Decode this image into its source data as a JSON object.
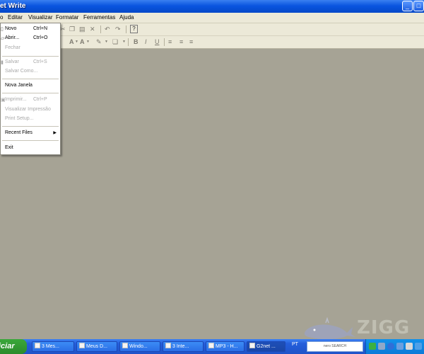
{
  "window": {
    "title": "et Write"
  },
  "menubar": {
    "items": [
      "o",
      "Editar",
      "Visualizar",
      "Formatar",
      "Ferramentas",
      "Ajuda"
    ]
  },
  "file_menu": {
    "items": [
      {
        "label": "Novo",
        "shortcut": "Ctrl+N"
      },
      {
        "label": "Abrir...",
        "shortcut": "Ctrl+O"
      },
      {
        "label": "Fechar",
        "shortcut": ""
      },
      {
        "label": "Salvar",
        "shortcut": "Ctrl+S"
      },
      {
        "label": "Salvar Como...",
        "shortcut": ""
      },
      {
        "label": "Nova Janela",
        "shortcut": ""
      },
      {
        "label": "Imprimir...",
        "shortcut": "Ctrl+P"
      },
      {
        "label": "Visualizar Impressão",
        "shortcut": ""
      },
      {
        "label": "Print Setup...",
        "shortcut": ""
      },
      {
        "label": "Recent Files",
        "shortcut": ""
      },
      {
        "label": "Exit",
        "shortcut": ""
      }
    ]
  },
  "toolbar": {
    "bold": "B",
    "italic": "I",
    "underline": "U",
    "font_color": "A",
    "font_bg": "A"
  },
  "watermark": {
    "text": "ZIGG"
  },
  "taskbar": {
    "start_label": "iciar",
    "tasks": [
      "3 Mes...",
      "Meus D...",
      "Windo...",
      "3 Inte...",
      "MP3 - H...",
      "G2net ..."
    ],
    "language": "PT",
    "search_brand": "nero SEARCH"
  }
}
